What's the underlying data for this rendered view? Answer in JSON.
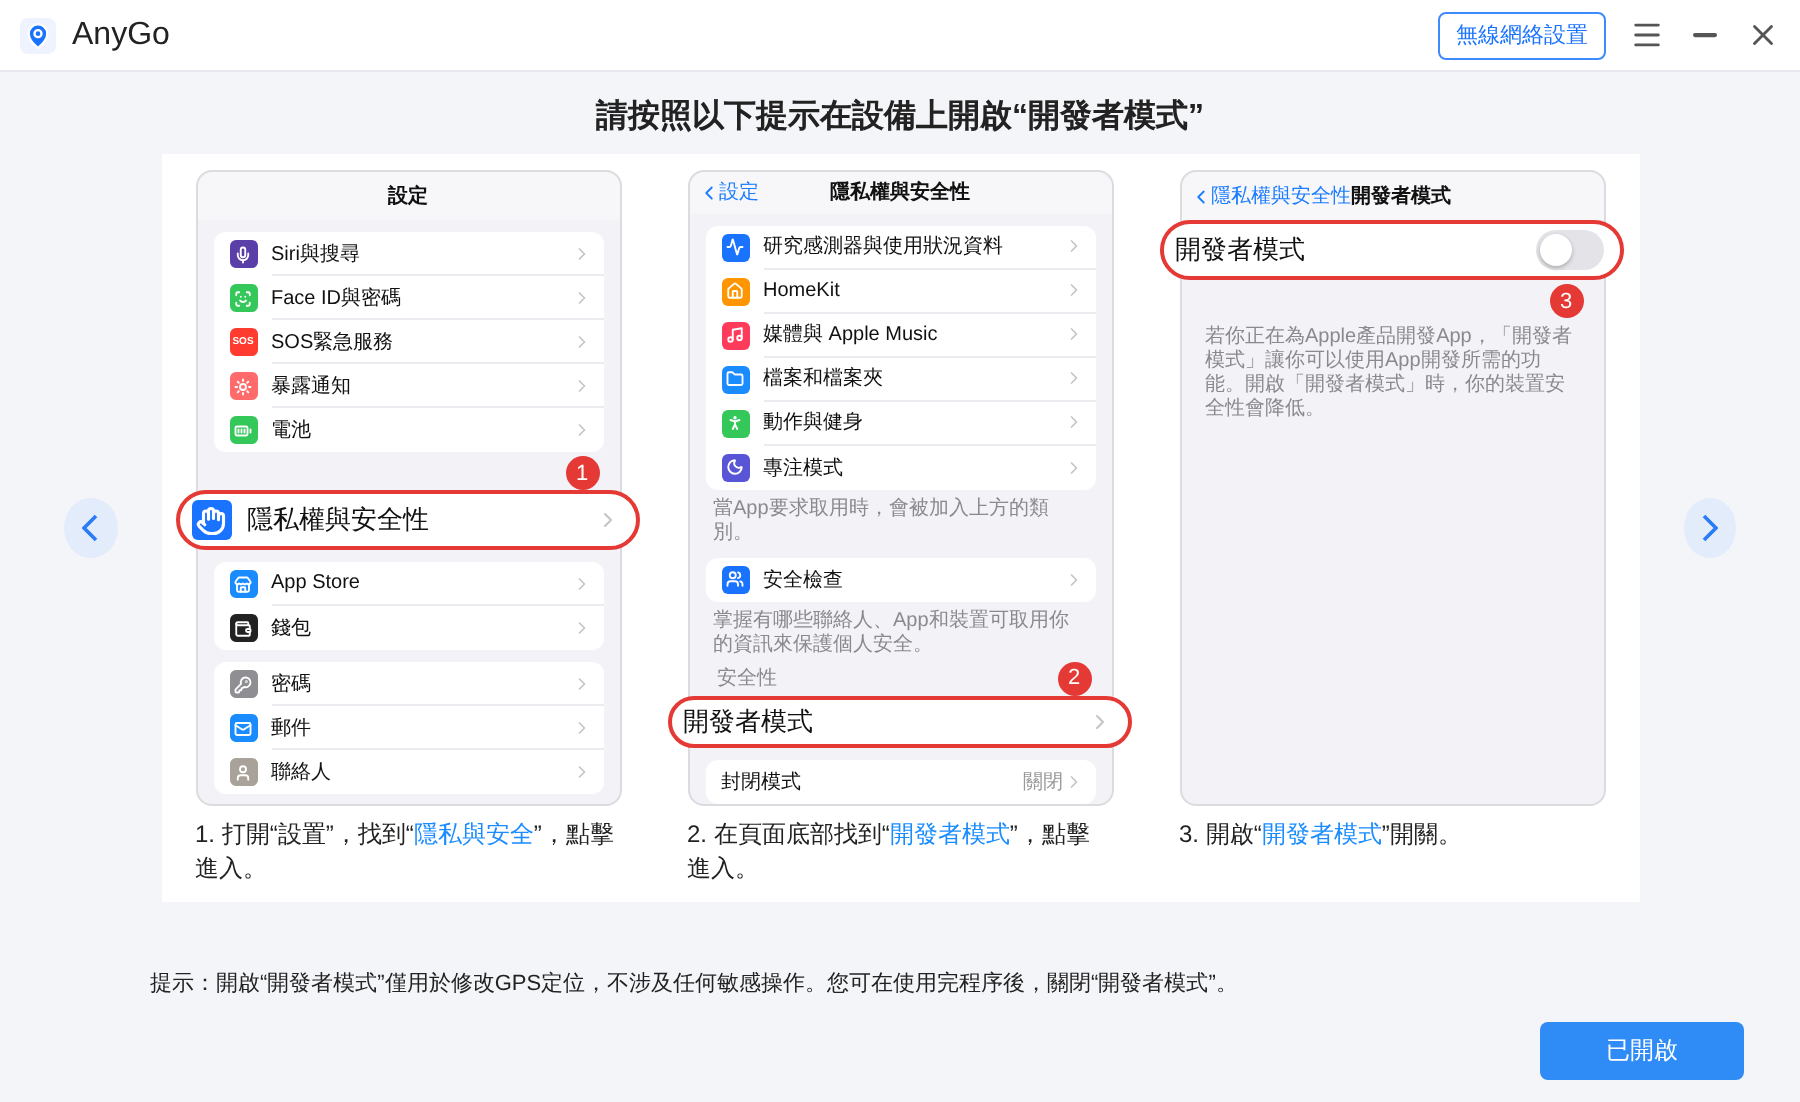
{
  "window": {
    "app_name": "AnyGo",
    "wifi_button": "無線網絡設置"
  },
  "heading": "請按照以下提示在設備上開啟“開發者模式”",
  "steps": [
    {
      "screen": {
        "nav": {
          "title": "設定"
        },
        "blocks": [
          {
            "kind": "group",
            "rows": [
              {
                "kind": "siri",
                "color": "#5b3fa8",
                "label": "Siri與搜尋"
              },
              {
                "kind": "face",
                "color": "#34c759",
                "label": "Face ID與密碼"
              },
              {
                "kind": "sos",
                "color": "#ff3b30",
                "icon_text": "SOS",
                "label": "SOS緊急服務"
              },
              {
                "kind": "sun",
                "color": "#ff6b6b",
                "label": "暴露通知"
              },
              {
                "kind": "battery",
                "color": "#34c759",
                "label": "電池"
              }
            ]
          },
          {
            "kind": "badge",
            "text": "1"
          },
          {
            "kind": "highlight",
            "row": {
              "kind": "hand",
              "color": "#1a73ff",
              "label": "隱私權與安全性"
            }
          },
          {
            "kind": "group",
            "rows": [
              {
                "kind": "store",
                "color": "#1a8cff",
                "label": "App Store"
              },
              {
                "kind": "wallet",
                "color": "#222222",
                "label": "錢包"
              }
            ]
          },
          {
            "kind": "group",
            "rows": [
              {
                "kind": "key",
                "color": "#8e8e93",
                "label": "密碼"
              },
              {
                "kind": "mail",
                "color": "#1a8cff",
                "label": "郵件"
              },
              {
                "kind": "user",
                "color": "#a8a29a",
                "label": "聯絡人"
              }
            ]
          }
        ]
      },
      "caption": [
        {
          "text": "1. 打開“設置”，找到“",
          "highlight": false
        },
        {
          "text": "隱私與安全",
          "highlight": true
        },
        {
          "text": "”，點擊進入。",
          "highlight": false
        }
      ]
    },
    {
      "screen": {
        "nav": {
          "back": "設定",
          "title": "隱私權與安全性"
        },
        "blocks": [
          {
            "kind": "group",
            "rows": [
              {
                "kind": "chart",
                "color": "#1a73ff",
                "label": "研究感測器與使用狀況資料"
              },
              {
                "kind": "home",
                "color": "#ff9500",
                "label": "HomeKit"
              },
              {
                "kind": "music",
                "color": "#ff3b5c",
                "label": "媒體與 Apple Music"
              },
              {
                "kind": "folder",
                "color": "#1a8cff",
                "label": "檔案和檔案夾"
              },
              {
                "kind": "run",
                "color": "#34c759",
                "label": "動作與健身"
              },
              {
                "kind": "moon",
                "color": "#5856d6",
                "label": "專注模式"
              }
            ]
          },
          {
            "kind": "note",
            "text": "當App要求取用時，會被加入上方的類別。"
          },
          {
            "kind": "group",
            "rows": [
              {
                "kind": "users",
                "color": "#1a73ff",
                "label": "安全檢查"
              }
            ]
          },
          {
            "kind": "note",
            "text": "掌握有哪些聯絡人、App和裝置可取用你的資訊來保護個人安全。"
          },
          {
            "kind": "section",
            "text": "安全性",
            "badge": "2"
          },
          {
            "kind": "highlight",
            "row": {
              "kind": "plain",
              "label": "開發者模式"
            }
          },
          {
            "kind": "group",
            "rows": [
              {
                "kind": "plain",
                "label": "封閉模式",
                "value": "關閉"
              }
            ]
          }
        ]
      },
      "caption": [
        {
          "text": "2. 在頁面底部找到“",
          "highlight": false
        },
        {
          "text": "開發者模式",
          "highlight": true
        },
        {
          "text": "”，點擊進入。",
          "highlight": false
        }
      ]
    },
    {
      "screen": {
        "nav": {
          "back": "隱私權與安全性",
          "title": "開發者模式"
        },
        "blocks": [
          {
            "kind": "highlight",
            "row": {
              "kind": "toggle",
              "label": "開發者模式",
              "on": false
            }
          },
          {
            "kind": "badge",
            "text": "3"
          },
          {
            "kind": "note",
            "text": "若你正在為Apple產品開發App，「開發者模式」讓你可以使用App開發所需的功能。開啟「開發者模式」時，你的裝置安全性會降低。"
          }
        ]
      },
      "caption": [
        {
          "text": "3. 開啟“",
          "highlight": false
        },
        {
          "text": "開發者模式",
          "highlight": true
        },
        {
          "text": "”開關。",
          "highlight": false
        }
      ]
    }
  ],
  "tip": "提示：開啟“開發者模式”僅用於修改GPS定位，不涉及任何敏感操作。您可在使用完程序後，關閉“開發者模式”。",
  "confirm_button": "已開啟"
}
